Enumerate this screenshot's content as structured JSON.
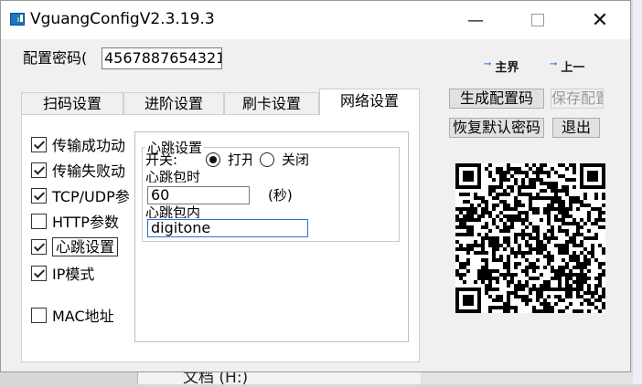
{
  "window": {
    "title": "VguangConfigV2.3.19.3",
    "controls": {
      "minimize": "—",
      "close": "✕"
    }
  },
  "config_password": {
    "label": "配置密码(",
    "value": "4567887654321"
  },
  "nav": {
    "main": "主界",
    "prev": "上一",
    "arrow": "→"
  },
  "tabs": [
    {
      "label": "扫码设置",
      "active": false
    },
    {
      "label": "进阶设置",
      "active": false
    },
    {
      "label": "刷卡设置",
      "active": false
    },
    {
      "label": "网络设置",
      "active": true
    }
  ],
  "checkboxes": [
    {
      "label": "传输成功动",
      "checked": true
    },
    {
      "label": "传输失败动",
      "checked": true
    },
    {
      "label": "TCP/UDP参",
      "checked": true
    },
    {
      "label": "HTTP参数",
      "checked": false
    },
    {
      "label": "心跳设置",
      "checked": true
    },
    {
      "label": "IP模式",
      "checked": true
    },
    {
      "label": "MAC地址",
      "checked": false
    }
  ],
  "heartbeat": {
    "title": "心跳设置",
    "switch_label": "开关:",
    "on_label": "打开",
    "off_label": "关闭",
    "selected": "on",
    "interval_label": "心跳包时",
    "interval_value": "60",
    "interval_unit": "(秒)",
    "content_label": "心跳包内",
    "content_value": "digitone"
  },
  "buttons": {
    "generate": "生成配置码",
    "save": "保存配置",
    "reset_password": "恢复默认密码",
    "exit": "退出"
  },
  "background": {
    "bottom_text": "文档 (H:)"
  },
  "colors": {
    "nav_arrow": "#1e73d6",
    "focus_border": "#2b6fd6",
    "disabled_text": "#9a9a9a"
  }
}
